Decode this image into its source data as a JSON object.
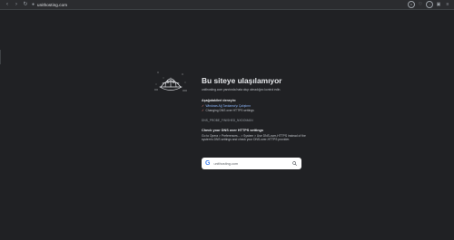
{
  "toolbar": {
    "url": "unithosting.com",
    "back_icon": "back-arrow-icon",
    "forward_icon": "forward-arrow-icon",
    "reload_icon": "reload-icon"
  },
  "error": {
    "title": "Bu siteye ulaşılamıyor",
    "subtitle": "unithosting.com yanıtında hata olup olmadığını kontrol edin.",
    "try_heading": "Aşağıdakileri deneyin:",
    "try_items": [
      {
        "label": "Windows Ağ Tanılama'yı Çalıştırın",
        "link": true
      },
      {
        "label": "Changing DNS over HTTPS settings",
        "link": false
      }
    ],
    "error_code": "DNS_PROBE_FINISHED_NXDOMAIN",
    "doh_heading": "Check your DNS over HTTPS settings",
    "doh_body": "Go to Opera > Preferences... > System > Use DNS-over-HTTPS instead of the system's DNS settings and check your DNS-over-HTTPS provider."
  },
  "search": {
    "value": "unithosting.com"
  },
  "colors": {
    "background": "#202124",
    "link": "#8ab4f8",
    "bullet": "#f28b82"
  }
}
